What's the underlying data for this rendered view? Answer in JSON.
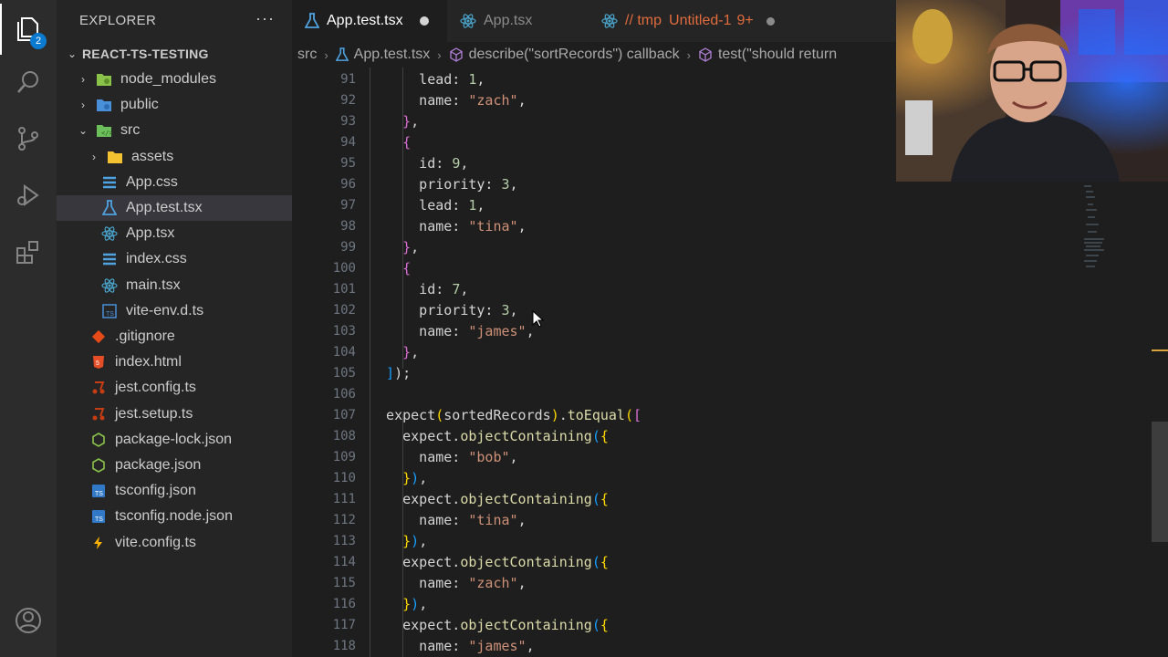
{
  "activity_bar": {
    "explorer_badge": "2"
  },
  "sidebar": {
    "title": "EXPLORER",
    "more": "···",
    "project": "REACT-TS-TESTING",
    "tree": [
      {
        "name": "node_modules",
        "kind": "folder-node",
        "depth": 1,
        "twist": "›"
      },
      {
        "name": "public",
        "kind": "folder-public",
        "depth": 1,
        "twist": "›"
      },
      {
        "name": "src",
        "kind": "folder-src",
        "depth": 1,
        "twist": "⌄"
      },
      {
        "name": "assets",
        "kind": "folder",
        "depth": 2,
        "twist": "›"
      },
      {
        "name": "App.css",
        "kind": "css",
        "depth": 2,
        "twist": ""
      },
      {
        "name": "App.test.tsx",
        "kind": "test",
        "depth": 2,
        "twist": "",
        "selected": true
      },
      {
        "name": "App.tsx",
        "kind": "react",
        "depth": 2,
        "twist": ""
      },
      {
        "name": "index.css",
        "kind": "css",
        "depth": 2,
        "twist": ""
      },
      {
        "name": "main.tsx",
        "kind": "react",
        "depth": 2,
        "twist": ""
      },
      {
        "name": "vite-env.d.ts",
        "kind": "ts-def",
        "depth": 2,
        "twist": ""
      },
      {
        "name": ".gitignore",
        "kind": "git",
        "depth": 1,
        "twist": ""
      },
      {
        "name": "index.html",
        "kind": "html",
        "depth": 1,
        "twist": ""
      },
      {
        "name": "jest.config.ts",
        "kind": "jest",
        "depth": 1,
        "twist": ""
      },
      {
        "name": "jest.setup.ts",
        "kind": "jest",
        "depth": 1,
        "twist": ""
      },
      {
        "name": "package-lock.json",
        "kind": "npm",
        "depth": 1,
        "twist": ""
      },
      {
        "name": "package.json",
        "kind": "npm",
        "depth": 1,
        "twist": ""
      },
      {
        "name": "tsconfig.json",
        "kind": "ts",
        "depth": 1,
        "twist": ""
      },
      {
        "name": "tsconfig.node.json",
        "kind": "ts",
        "depth": 1,
        "twist": ""
      },
      {
        "name": "vite.config.ts",
        "kind": "vite",
        "depth": 1,
        "twist": ""
      }
    ]
  },
  "tabs": [
    {
      "label": "App.test.tsx",
      "active": true,
      "modified": true
    },
    {
      "label": "App.tsx",
      "active": false
    },
    {
      "prefix": "// tmp",
      "label": "Untitled-1",
      "problems": "9+",
      "active": false,
      "modified": true
    }
  ],
  "breadcrumbs": {
    "folder": "src",
    "file": "App.test.tsx",
    "scope1": "describe(\"sortRecords\") callback",
    "scope2": "test(\"should return"
  },
  "editor": {
    "line_numbers": [
      "91",
      "92",
      "93",
      "94",
      "95",
      "96",
      "97",
      "98",
      "99",
      "100",
      "101",
      "102",
      "103",
      "104",
      "105",
      "106",
      "107",
      "108",
      "109",
      "110",
      "111",
      "112",
      "113",
      "114",
      "115",
      "116",
      "117",
      "118"
    ],
    "lines": [
      [
        [
          "k",
          "      lead: "
        ],
        [
          "n",
          "1"
        ],
        [
          "p",
          ","
        ]
      ],
      [
        [
          "k",
          "      name: "
        ],
        [
          "s",
          "\"zach\""
        ],
        [
          "p",
          ","
        ]
      ],
      [
        [
          "b2",
          "    }"
        ],
        [
          "p",
          ","
        ]
      ],
      [
        [
          "b2",
          "    {"
        ]
      ],
      [
        [
          "k",
          "      id: "
        ],
        [
          "n",
          "9"
        ],
        [
          "p",
          ","
        ]
      ],
      [
        [
          "k",
          "      priority: "
        ],
        [
          "n",
          "3"
        ],
        [
          "p",
          ","
        ]
      ],
      [
        [
          "k",
          "      lead: "
        ],
        [
          "n",
          "1"
        ],
        [
          "p",
          ","
        ]
      ],
      [
        [
          "k",
          "      name: "
        ],
        [
          "s",
          "\"tina\""
        ],
        [
          "p",
          ","
        ]
      ],
      [
        [
          "b2",
          "    }"
        ],
        [
          "p",
          ","
        ]
      ],
      [
        [
          "b2",
          "    {"
        ]
      ],
      [
        [
          "k",
          "      id: "
        ],
        [
          "n",
          "7"
        ],
        [
          "p",
          ","
        ]
      ],
      [
        [
          "k",
          "      priority: "
        ],
        [
          "n",
          "3"
        ],
        [
          "p",
          ","
        ]
      ],
      [
        [
          "k",
          "      name: "
        ],
        [
          "s",
          "\"james\""
        ],
        [
          "p",
          ","
        ]
      ],
      [
        [
          "b2",
          "    }"
        ],
        [
          "p",
          ","
        ]
      ],
      [
        [
          "b3",
          "  ]"
        ],
        [
          "p",
          ");"
        ]
      ],
      [
        [
          "p",
          ""
        ]
      ],
      [
        [
          "k",
          "  expect"
        ],
        [
          "b1",
          "("
        ],
        [
          "k",
          "sortedRecords"
        ],
        [
          "b1",
          ")"
        ],
        [
          "p",
          "."
        ],
        [
          "meth",
          "toEqual"
        ],
        [
          "b1",
          "("
        ],
        [
          "b2",
          "["
        ]
      ],
      [
        [
          "k",
          "    expect."
        ],
        [
          "meth",
          "objectContaining"
        ],
        [
          "b3",
          "("
        ],
        [
          "b1",
          "{"
        ]
      ],
      [
        [
          "k",
          "      name: "
        ],
        [
          "s",
          "\"bob\""
        ],
        [
          "p",
          ","
        ]
      ],
      [
        [
          "b1",
          "    }"
        ],
        [
          "b3",
          ")"
        ],
        [
          "p",
          ","
        ]
      ],
      [
        [
          "k",
          "    expect."
        ],
        [
          "meth",
          "objectContaining"
        ],
        [
          "b3",
          "("
        ],
        [
          "b1",
          "{"
        ]
      ],
      [
        [
          "k",
          "      name: "
        ],
        [
          "s",
          "\"tina\""
        ],
        [
          "p",
          ","
        ]
      ],
      [
        [
          "b1",
          "    }"
        ],
        [
          "b3",
          ")"
        ],
        [
          "p",
          ","
        ]
      ],
      [
        [
          "k",
          "    expect."
        ],
        [
          "meth",
          "objectContaining"
        ],
        [
          "b3",
          "("
        ],
        [
          "b1",
          "{"
        ]
      ],
      [
        [
          "k",
          "      name: "
        ],
        [
          "s",
          "\"zach\""
        ],
        [
          "p",
          ","
        ]
      ],
      [
        [
          "b1",
          "    }"
        ],
        [
          "b3",
          ")"
        ],
        [
          "p",
          ","
        ]
      ],
      [
        [
          "k",
          "    expect."
        ],
        [
          "meth",
          "objectContaining"
        ],
        [
          "b3",
          "("
        ],
        [
          "b1",
          "{"
        ]
      ],
      [
        [
          "k",
          "      name: "
        ],
        [
          "s",
          "\"james\""
        ],
        [
          "p",
          ","
        ]
      ]
    ]
  },
  "colors": {
    "accent_badge": "#0b7ad1",
    "modified_dot": "#d4d4d4",
    "tmp_tab": "#e06c3c"
  }
}
